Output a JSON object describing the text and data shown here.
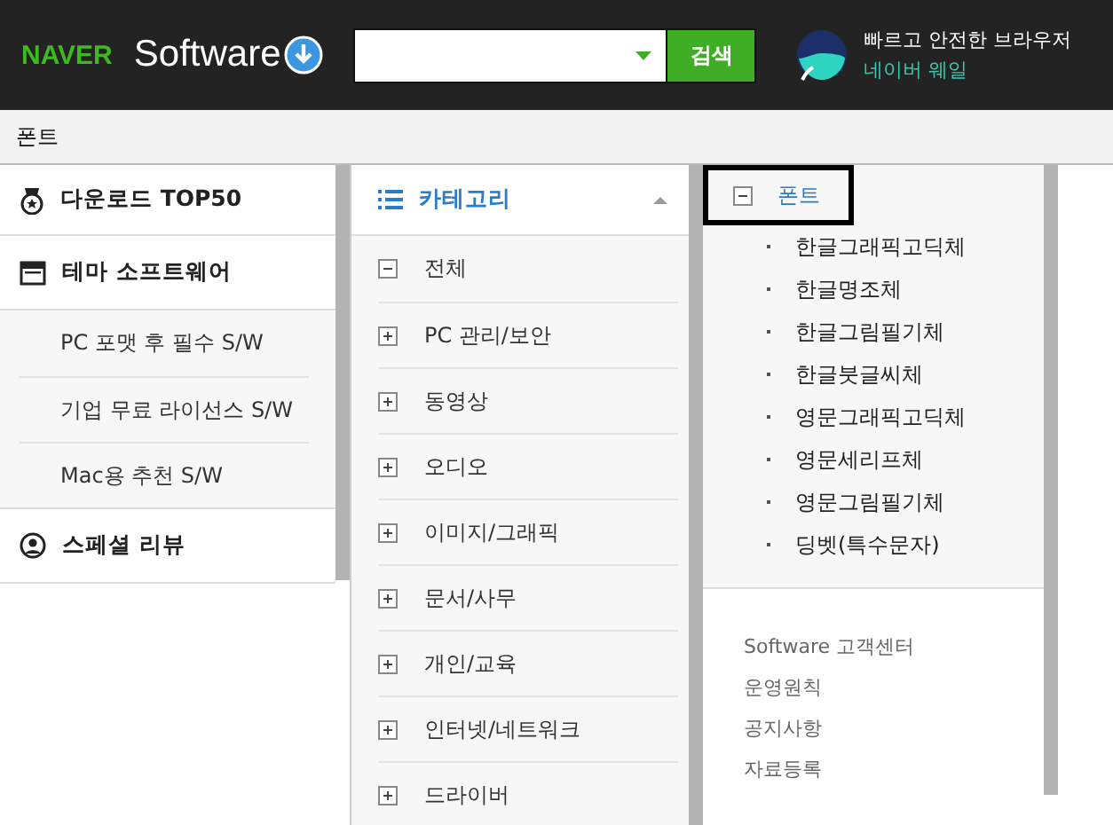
{
  "header": {
    "logo": "NAVER",
    "brand": "Software",
    "search": {
      "button": "검색"
    },
    "promo": {
      "line1": "빠르고 안전한 브라우저",
      "line2": "네이버 웨일"
    }
  },
  "breadcrumb": "폰트",
  "left_menu": [
    {
      "kind": "section",
      "label": "다운로드 TOP50"
    },
    {
      "kind": "section",
      "label": "테마 소프트웨어"
    },
    {
      "kind": "sub",
      "label": "PC 포맷 후 필수 S/W"
    },
    {
      "kind": "sub",
      "label": "기업 무료 라이선스 S/W"
    },
    {
      "kind": "sub",
      "label": "Mac용 추천 S/W"
    },
    {
      "kind": "section",
      "label": "스페셜 리뷰"
    }
  ],
  "categories": {
    "title": "카테고리",
    "expanded": true,
    "items": [
      {
        "label": "전체",
        "expanded": true
      },
      {
        "label": "PC 관리/보안",
        "expanded": false
      },
      {
        "label": "동영상",
        "expanded": false
      },
      {
        "label": "오디오",
        "expanded": false
      },
      {
        "label": "이미지/그래픽",
        "expanded": false
      },
      {
        "label": "문서/사무",
        "expanded": false
      },
      {
        "label": "개인/교육",
        "expanded": false
      },
      {
        "label": "인터넷/네트워크",
        "expanded": false
      },
      {
        "label": "드라이버",
        "expanded": false
      }
    ]
  },
  "subcategory": {
    "label": "폰트",
    "expanded": true,
    "selected": true,
    "children": [
      {
        "label": "한글그래픽고딕체"
      },
      {
        "label": "한글명조체"
      },
      {
        "label": "한글그림필기체"
      },
      {
        "label": "한글붓글씨체"
      },
      {
        "label": "영문그래픽고딕체"
      },
      {
        "label": "영문세리프체"
      },
      {
        "label": "영문그림필기체"
      },
      {
        "label": "딩벳(특수문자)"
      }
    ]
  },
  "footer_links": [
    "Software 고객센터",
    "운영원칙",
    "공지사항",
    "자료등록"
  ]
}
